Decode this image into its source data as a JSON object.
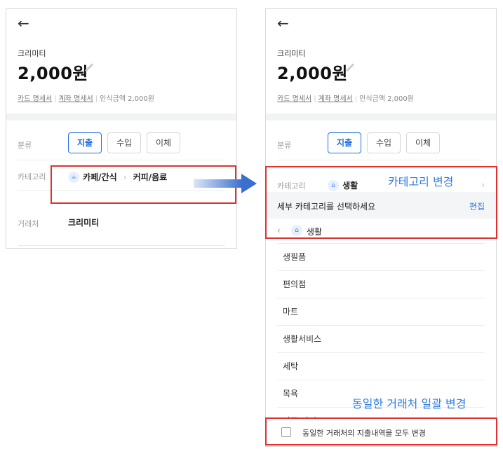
{
  "transaction": {
    "merchant": "크리미티",
    "amount": "2,000원",
    "card_statement_link": "카드 명세서",
    "account_statement_link": "계좌 명세서",
    "recognized_amount": "인식금액 2,000원"
  },
  "form": {
    "classification_label": "분류",
    "types": [
      "지출",
      "수입",
      "이체"
    ],
    "selected_type": "지출",
    "category_label": "카테고리",
    "category_main": "카페/간식",
    "category_sub": "커피/음료",
    "merchant_label": "거래처",
    "merchant_value": "크리미티"
  },
  "right": {
    "category_current": "생활",
    "sheet_title": "세부 카테고리를 선택하세요",
    "sheet_edit": "편집",
    "parent_category": "생활",
    "subcategories": [
      "생필품",
      "편의점",
      "마트",
      "생활서비스",
      "세탁",
      "목욕",
      "가구/가전"
    ],
    "bulk_change_checkbox_label": "동일한 거래처의 지출내역을 모두 변경"
  },
  "annotations": {
    "category_change": "카테고리 변경",
    "bulk_change": "동일한 거래처 일괄 변경"
  },
  "icons": {
    "back": "left-arrow-icon",
    "edit": "pencil-icon",
    "cafe": "coffee-cup-icon",
    "life": "basket-icon",
    "chevron": "chevron-right-icon"
  },
  "colors": {
    "accent": "#1f6fe5",
    "annotation_blue": "#2f7be0",
    "highlight_red": "#e03030"
  }
}
